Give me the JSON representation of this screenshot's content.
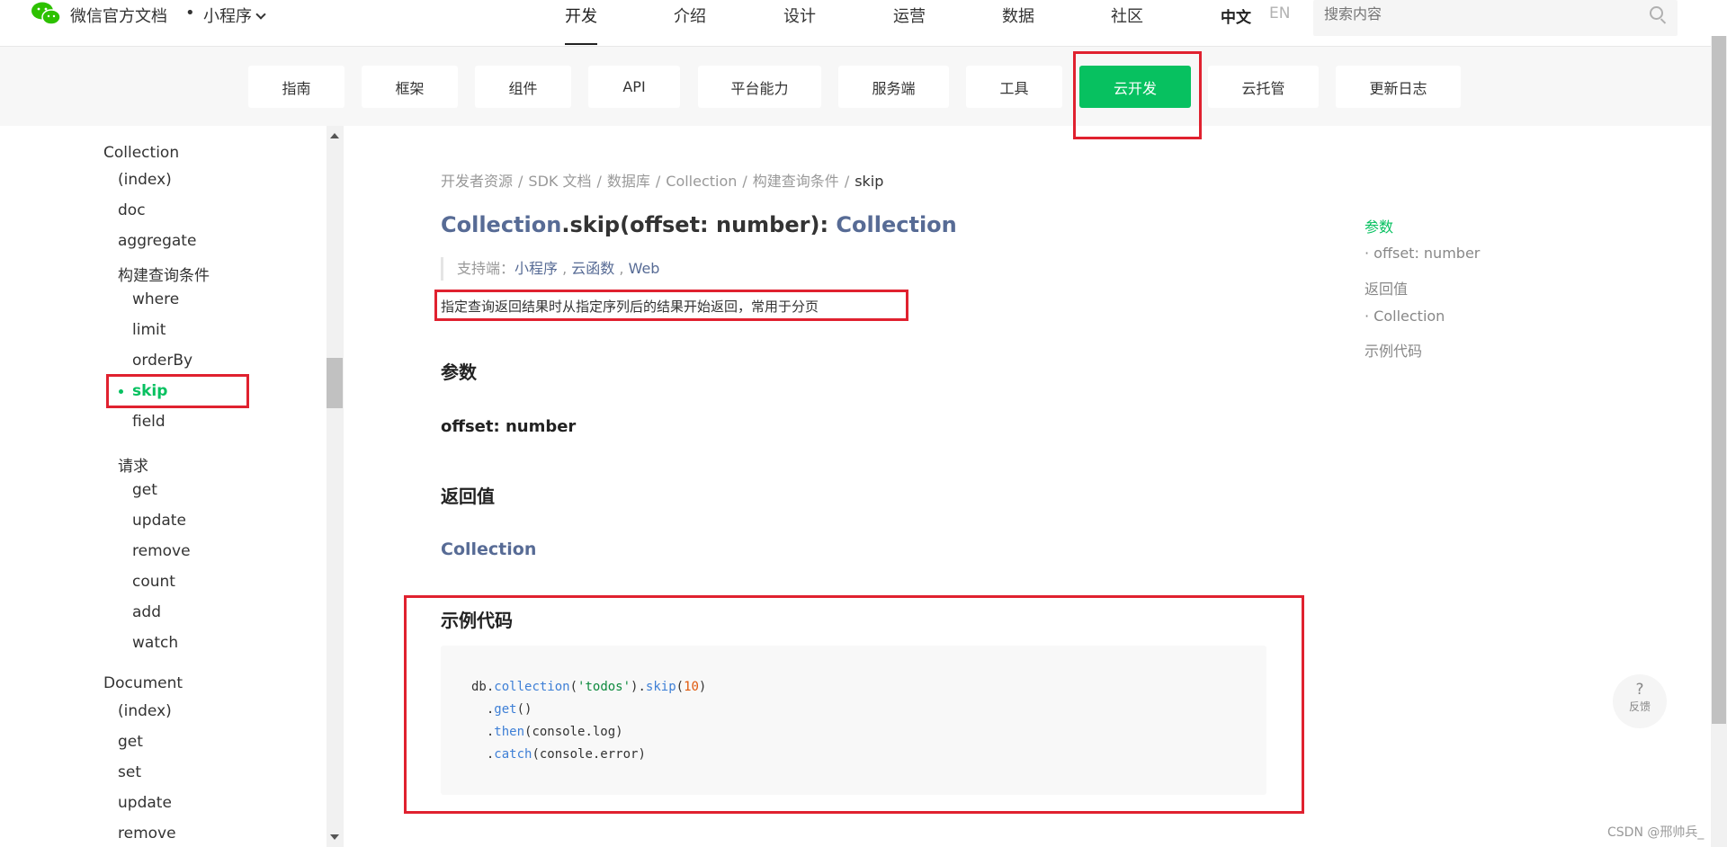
{
  "header": {
    "site_title": "微信官方文档",
    "separator": "•",
    "product": "小程序",
    "nav": [
      "开发",
      "介绍",
      "设计",
      "运营",
      "数据",
      "社区"
    ],
    "lang_zh": "中文",
    "lang_en": "EN",
    "search_placeholder": "搜索内容"
  },
  "tabs": [
    "指南",
    "框架",
    "组件",
    "API",
    "平台能力",
    "服务端",
    "工具",
    "云开发",
    "云托管",
    "更新日志"
  ],
  "sidebar": {
    "items": [
      "Collection",
      "(index)",
      "doc",
      "aggregate",
      "构建查询条件",
      "where",
      "limit",
      "orderBy",
      "skip",
      "field",
      "请求",
      "get",
      "update",
      "remove",
      "count",
      "add",
      "watch",
      "Document",
      "(index)",
      "get",
      "set",
      "update",
      "remove"
    ]
  },
  "breadcrumb": [
    "开发者资源",
    "SDK 文档",
    "数据库",
    "Collection",
    "构建查询条件",
    "skip"
  ],
  "doc": {
    "title_class": "Collection",
    "title_method": ".skip(offset: number): ",
    "title_return": "Collection",
    "support_label": "支持端：",
    "platforms": [
      "小程序",
      "云函数",
      "Web"
    ],
    "description": "指定查询返回结果时从指定序列后的结果开始返回，常用于分页",
    "params_heading": "参数",
    "param_name": "offset: number",
    "return_heading": "返回值",
    "return_type": "Collection",
    "example_heading": "示例代码",
    "code": {
      "line1_obj": "db.",
      "line1_fn": "collection",
      "line1_open": "(",
      "line1_str": "'todos'",
      "line1_mid": ").",
      "line1_fn2": "skip",
      "line1_open2": "(",
      "line1_num": "10",
      "line1_close": ")",
      "line2_dot": "  .",
      "line2_fn": "get",
      "line2_args": "()",
      "line3_dot": "  .",
      "line3_fn": "then",
      "line3_args": "(console.log)",
      "line4_dot": "  .",
      "line4_fn": "catch",
      "line4_args": "(console.error)"
    }
  },
  "toc": [
    "参数",
    "· offset: number",
    "返回值",
    "· Collection",
    "示例代码"
  ],
  "feedback": {
    "q": "?",
    "label": "反馈"
  },
  "watermark": "CSDN @邢帅兵_",
  "colors": {
    "accent": "#07c160",
    "link": "#576b95",
    "annotation": "#e0212f"
  }
}
